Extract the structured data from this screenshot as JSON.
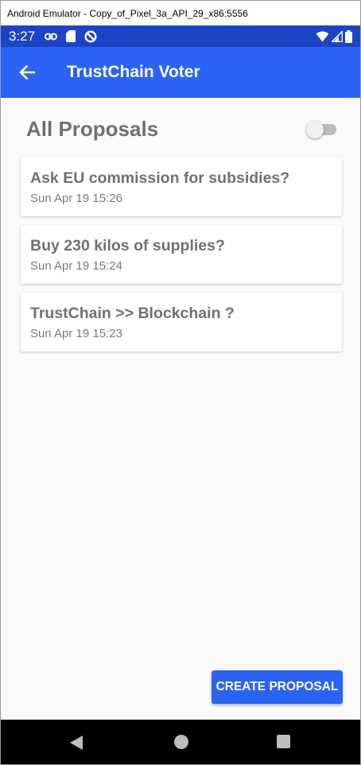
{
  "window": {
    "title": "Android Emulator - Copy_of_Pixel_3a_API_29_x86:5556"
  },
  "status_bar": {
    "time": "3:27",
    "left_icons": [
      "link-icon",
      "sd-card-icon",
      "data-saver-icon"
    ],
    "right_icons": [
      "wifi-icon",
      "cell-signal-icon",
      "battery-icon"
    ]
  },
  "app_bar": {
    "title": "TrustChain Voter",
    "back_icon": "arrow-back-icon"
  },
  "main": {
    "heading": "All Proposals",
    "toggle": {
      "on": false
    },
    "proposals": [
      {
        "title": "Ask EU commission for subsidies?",
        "date": "Sun Apr 19 15:26"
      },
      {
        "title": "Buy 230 kilos of supplies?",
        "date": "Sun Apr 19 15:24"
      },
      {
        "title": "TrustChain >> Blockchain ?",
        "date": "Sun Apr 19 15:23"
      }
    ],
    "create_button_label": "CREATE PROPOSAL"
  },
  "nav_bar": {
    "buttons": [
      "back-triangle-icon",
      "home-circle-icon",
      "recents-square-icon"
    ]
  },
  "colors": {
    "status_bar": "#1d43c7",
    "app_bar": "#2b63f5",
    "accent": "#2b63f5",
    "background": "#fafafa"
  }
}
